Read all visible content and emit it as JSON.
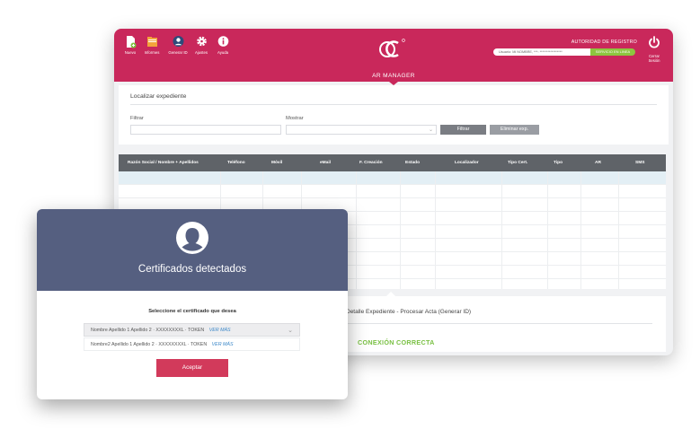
{
  "app": {
    "nav": [
      {
        "label": "Nuevo",
        "icon": "new-document-icon"
      },
      {
        "label": "Informes",
        "icon": "folder-icon"
      },
      {
        "label": "Generar ID",
        "icon": "user-id-icon"
      },
      {
        "label": "Ajustes",
        "icon": "gear-icon"
      },
      {
        "label": "Ayuda",
        "icon": "info-icon"
      }
    ],
    "section_title": "AR MANAGER",
    "ar_label": "AUTORIDAD DE REGISTRO",
    "user_text": "Usuario: Mi NOMBRE, ***: *****************",
    "online_button": "SERVICIO EN LINEA",
    "logout_label": "Cerrar Sesión"
  },
  "search": {
    "title": "Localizar expediente",
    "filter_label": "Filtrar",
    "show_label": "Mostrar",
    "filter_button": "Filtrar",
    "delete_button": "Eliminar exp."
  },
  "table": {
    "columns": [
      "Razón Social / Nombre + Apellidos",
      "Teléfono",
      "Móvil",
      "eMail",
      "F. Creación",
      "Estado",
      "Localizador",
      "Tipo Cert.",
      "Tipo",
      "AR",
      "SMS"
    ]
  },
  "detail": {
    "title": "Detalle Expediente - Procesar Acta (Generar ID)",
    "status": "CONEXIÓN CORRECTA"
  },
  "modal": {
    "title": "Certificados detectados",
    "prompt": "Seleccione el certificado que desea",
    "certificates": [
      {
        "text": "Nombre Apellido 1 Apellido 2 · XXXXXXXXL · TOKEN",
        "more": "VER MÁS"
      },
      {
        "text": "Nombre2 Apellido 1 Apellido 2 · XXXXXXXXL · TOKEN",
        "more": "VER MÁS"
      }
    ],
    "accept_button": "Aceptar"
  },
  "colors": {
    "brand": "#c9285b",
    "modal_header": "#555f80",
    "accent_green": "#79c043",
    "button": "#d23a5b"
  }
}
